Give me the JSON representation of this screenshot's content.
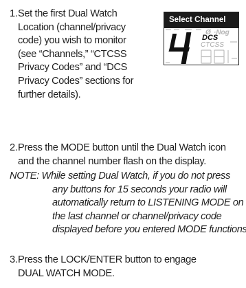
{
  "step1": {
    "num": "1.",
    "lines": [
      "Set the first Dual Watch",
      "Location (channel/privacy",
      "code) you wish to monitor",
      "(see “Channels,” “CTCSS",
      "Privacy Codes” and “DCS",
      "Privacy Codes” sections for",
      "further details)."
    ]
  },
  "figure": {
    "header": "Select Channel",
    "digit": "4",
    "dcs_label": "DCS",
    "ctcss_label": "CTCSS",
    "icon": "lcd-display-icon"
  },
  "step2": {
    "num": "2.",
    "lines": [
      "Press the MODE button until the Dual Watch icon",
      "and the channel number flash on the display."
    ]
  },
  "note": {
    "lines": [
      "NOTE: While setting Dual Watch, if you do not press",
      "any buttons for 15 seconds your radio will",
      "automatically return to LISTENING MODE on",
      "the last channel or channel/privacy code",
      "displayed before you entered MODE functions."
    ]
  },
  "step3": {
    "num": "3.",
    "lines": [
      "Press the LOCK/ENTER button to engage",
      "DUAL WATCH MODE."
    ]
  }
}
